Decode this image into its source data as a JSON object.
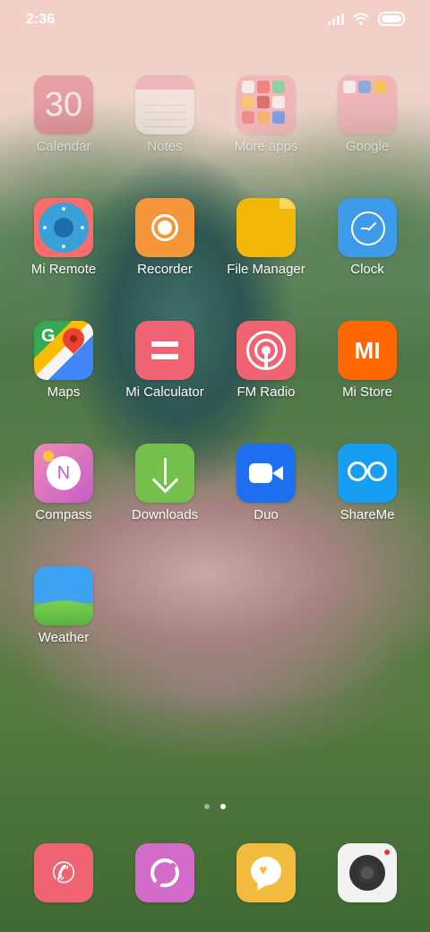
{
  "status_bar": {
    "time": "2:36"
  },
  "apps": [
    {
      "label": "Calendar",
      "icon": "calendar-icon",
      "icon_text": "30"
    },
    {
      "label": "Notes",
      "icon": "notes-icon"
    },
    {
      "label": "More apps",
      "icon": "folder-icon"
    },
    {
      "label": "Google",
      "icon": "folder-icon"
    },
    {
      "label": "Mi Remote",
      "icon": "remote-icon"
    },
    {
      "label": "Recorder",
      "icon": "recorder-icon"
    },
    {
      "label": "File Manager",
      "icon": "folder-icon"
    },
    {
      "label": "Clock",
      "icon": "clock-icon"
    },
    {
      "label": "Maps",
      "icon": "map-pin-icon"
    },
    {
      "label": "Mi Calculator",
      "icon": "calculator-icon"
    },
    {
      "label": "FM Radio",
      "icon": "radio-icon"
    },
    {
      "label": "Mi Store",
      "icon": "mi-logo-icon",
      "icon_text": "MI"
    },
    {
      "label": "Compass",
      "icon": "compass-icon",
      "icon_text": "N"
    },
    {
      "label": "Downloads",
      "icon": "download-arrow-icon"
    },
    {
      "label": "Duo",
      "icon": "video-camera-icon"
    },
    {
      "label": "ShareMe",
      "icon": "infinity-icon"
    },
    {
      "label": "Weather",
      "icon": "weather-icon"
    }
  ],
  "page_indicator": {
    "pages": 2,
    "current": 2
  },
  "dock": [
    {
      "name": "phone",
      "icon": "phone-icon"
    },
    {
      "name": "browser",
      "icon": "browser-icon"
    },
    {
      "name": "messages",
      "icon": "chat-bubble-icon"
    },
    {
      "name": "camera",
      "icon": "camera-icon"
    }
  ]
}
